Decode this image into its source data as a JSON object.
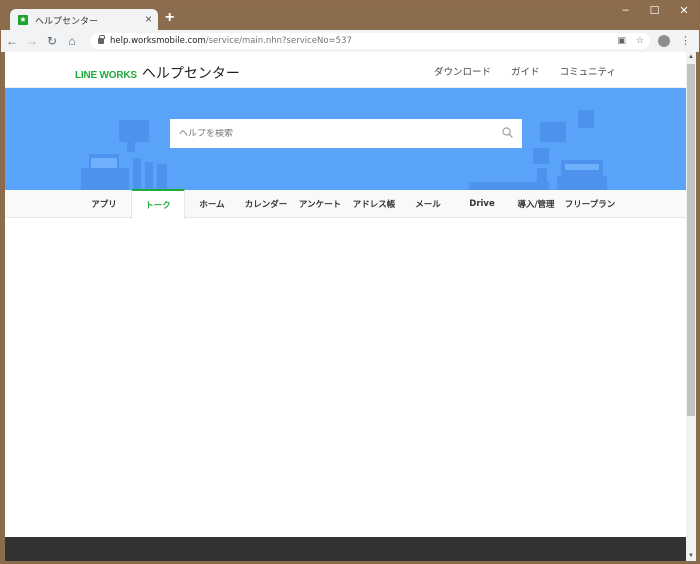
{
  "browser": {
    "tab_title": "ヘルプセンター",
    "tab_close": "×",
    "new_tab": "+",
    "url_host": "help.worksmobile.com",
    "url_path": "/service/main.nhn?serviceNo=537",
    "window_controls": {
      "minimize": "–",
      "maximize": "☐",
      "close": "✕"
    },
    "nav": {
      "back": "←",
      "forward": "→",
      "reload": "↻",
      "home": "⌂"
    }
  },
  "header": {
    "brand": "LINE WORKS",
    "title": "ヘルプセンター",
    "links": [
      "ダウンロード",
      "ガイド",
      "コミュニティ"
    ]
  },
  "hero": {
    "search_placeholder": "ヘルプを検索"
  },
  "category_tabs": [
    {
      "label": "アプリ",
      "active": false
    },
    {
      "label": "トーク",
      "active": true
    },
    {
      "label": "ホーム",
      "active": false
    },
    {
      "label": "カレンダー",
      "active": false
    },
    {
      "label": "アンケート",
      "active": false
    },
    {
      "label": "アドレス帳",
      "active": false
    },
    {
      "label": "メール",
      "active": false
    },
    {
      "label": "Drive",
      "active": false
    },
    {
      "label": "導入/管理",
      "active": false
    },
    {
      "label": "フリープラン",
      "active": false
    }
  ],
  "colors": {
    "brand_green": "#1faa3d",
    "hero_blue": "#5aa3fb",
    "frame_brown": "#8b6d4e"
  }
}
